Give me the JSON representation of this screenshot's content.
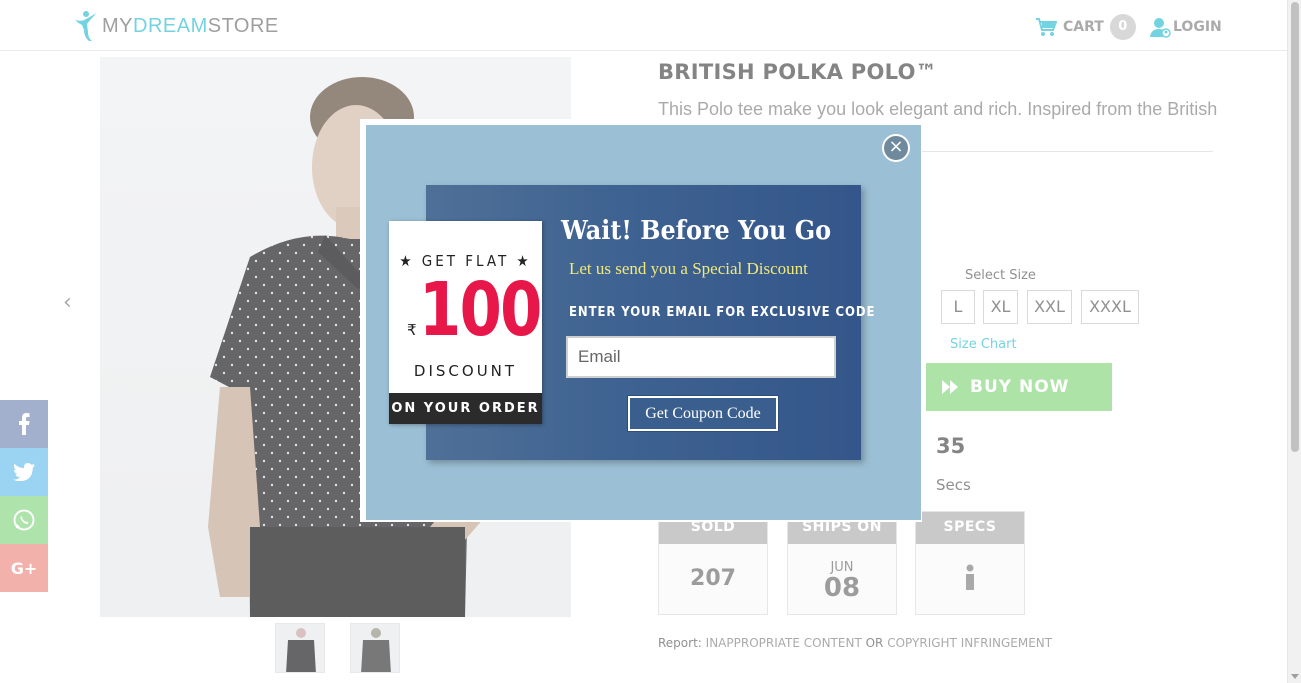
{
  "header": {
    "logo_part1": "MY",
    "logo_part2": "DREAM",
    "logo_part3": "STORE",
    "cart_label": "CART",
    "cart_count": "0",
    "login_label": "LOGIN"
  },
  "product": {
    "title": "BRITISH POLKA POLO™",
    "description": "This Polo tee make you look elegant and rich. Inspired from the British",
    "select_size_label": "Select Size",
    "sizes": [
      "L",
      "XL",
      "XXL",
      "XXXL"
    ],
    "size_chart_label": "Size Chart",
    "buy_now_label": "BUY NOW",
    "timer_value": "35",
    "timer_unit": "Secs"
  },
  "info_cards": {
    "sold_label": "SOLD",
    "sold_value": "207",
    "ships_label": "SHIPS ON",
    "ships_month": "JUN",
    "ships_day": "08",
    "specs_label": "SPECS",
    "specs_icon": "info-icon"
  },
  "report": {
    "prefix": "Report:",
    "link1": "INAPPROPRIATE CONTENT",
    "or": "OR",
    "link2": "COPYRIGHT INFRINGEMENT"
  },
  "share": {
    "facebook_icon": "facebook-icon",
    "twitter_icon": "twitter-icon",
    "whatsapp_icon": "whatsapp-icon",
    "google_plus_label": "G+"
  },
  "popup": {
    "coupon_top": "★ GET FLAT ★",
    "coupon_rupee": "₹",
    "coupon_amount": "100",
    "coupon_discount": "DISCOUNT",
    "coupon_bottom": "ON YOUR ORDER",
    "heading": "Wait! Before You Go",
    "subheading": "Let us send you a Special Discount",
    "email_label": "ENTER YOUR EMAIL FOR EXCLUSIVE CODE",
    "email_placeholder": "Email",
    "button_label": "Get Coupon Code",
    "close_symbol": "×"
  },
  "colors": {
    "accent": "#3ec3d5",
    "buy_now": "#8ed886",
    "discount": "#e8174a",
    "popup_bg": "#9bbfd4",
    "popup_panel": "#3e6291",
    "subheading": "#f1e97a"
  }
}
